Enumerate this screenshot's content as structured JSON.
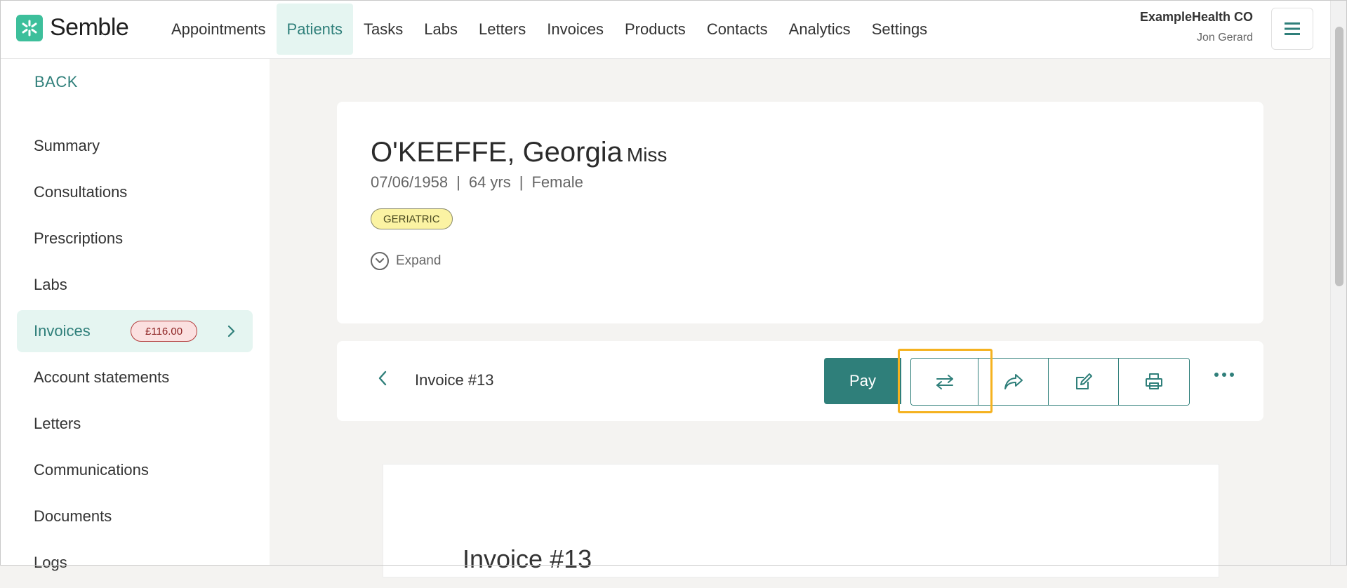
{
  "app": {
    "brand": "Semble"
  },
  "nav": {
    "items": [
      "Appointments",
      "Patients",
      "Tasks",
      "Labs",
      "Letters",
      "Invoices",
      "Products",
      "Contacts",
      "Analytics",
      "Settings"
    ],
    "active": "Patients"
  },
  "org": {
    "name": "ExampleHealth CO",
    "user": "Jon Gerard"
  },
  "sidebar": {
    "back_label": "BACK",
    "items": [
      {
        "label": "Summary"
      },
      {
        "label": "Consultations"
      },
      {
        "label": "Prescriptions"
      },
      {
        "label": "Labs"
      },
      {
        "label": "Invoices",
        "badge": "£116.00",
        "active": true
      },
      {
        "label": "Account statements"
      },
      {
        "label": "Letters"
      },
      {
        "label": "Communications"
      },
      {
        "label": "Documents"
      },
      {
        "label": "Logs"
      }
    ]
  },
  "patient": {
    "name": "O'KEEFFE, Georgia",
    "title": "Miss",
    "dob": "07/06/1958",
    "age": "64 yrs",
    "sex": "Female",
    "separator": "|",
    "tag": "GERIATRIC",
    "expand_label": "Expand"
  },
  "invoice": {
    "title": "Invoice #13",
    "pay_label": "Pay",
    "preview_title": "Invoice #13"
  },
  "colors": {
    "accent": "#2f7f7a",
    "highlight": "#f5b220",
    "badge_bg": "#fbe0e0",
    "tag_bg": "#fbf3a3"
  },
  "icons": [
    "menu-icon",
    "chevron-right-icon",
    "chevron-left-icon",
    "chevron-down-icon",
    "transfer-icon",
    "share-icon",
    "edit-icon",
    "print-icon",
    "more-icon"
  ]
}
